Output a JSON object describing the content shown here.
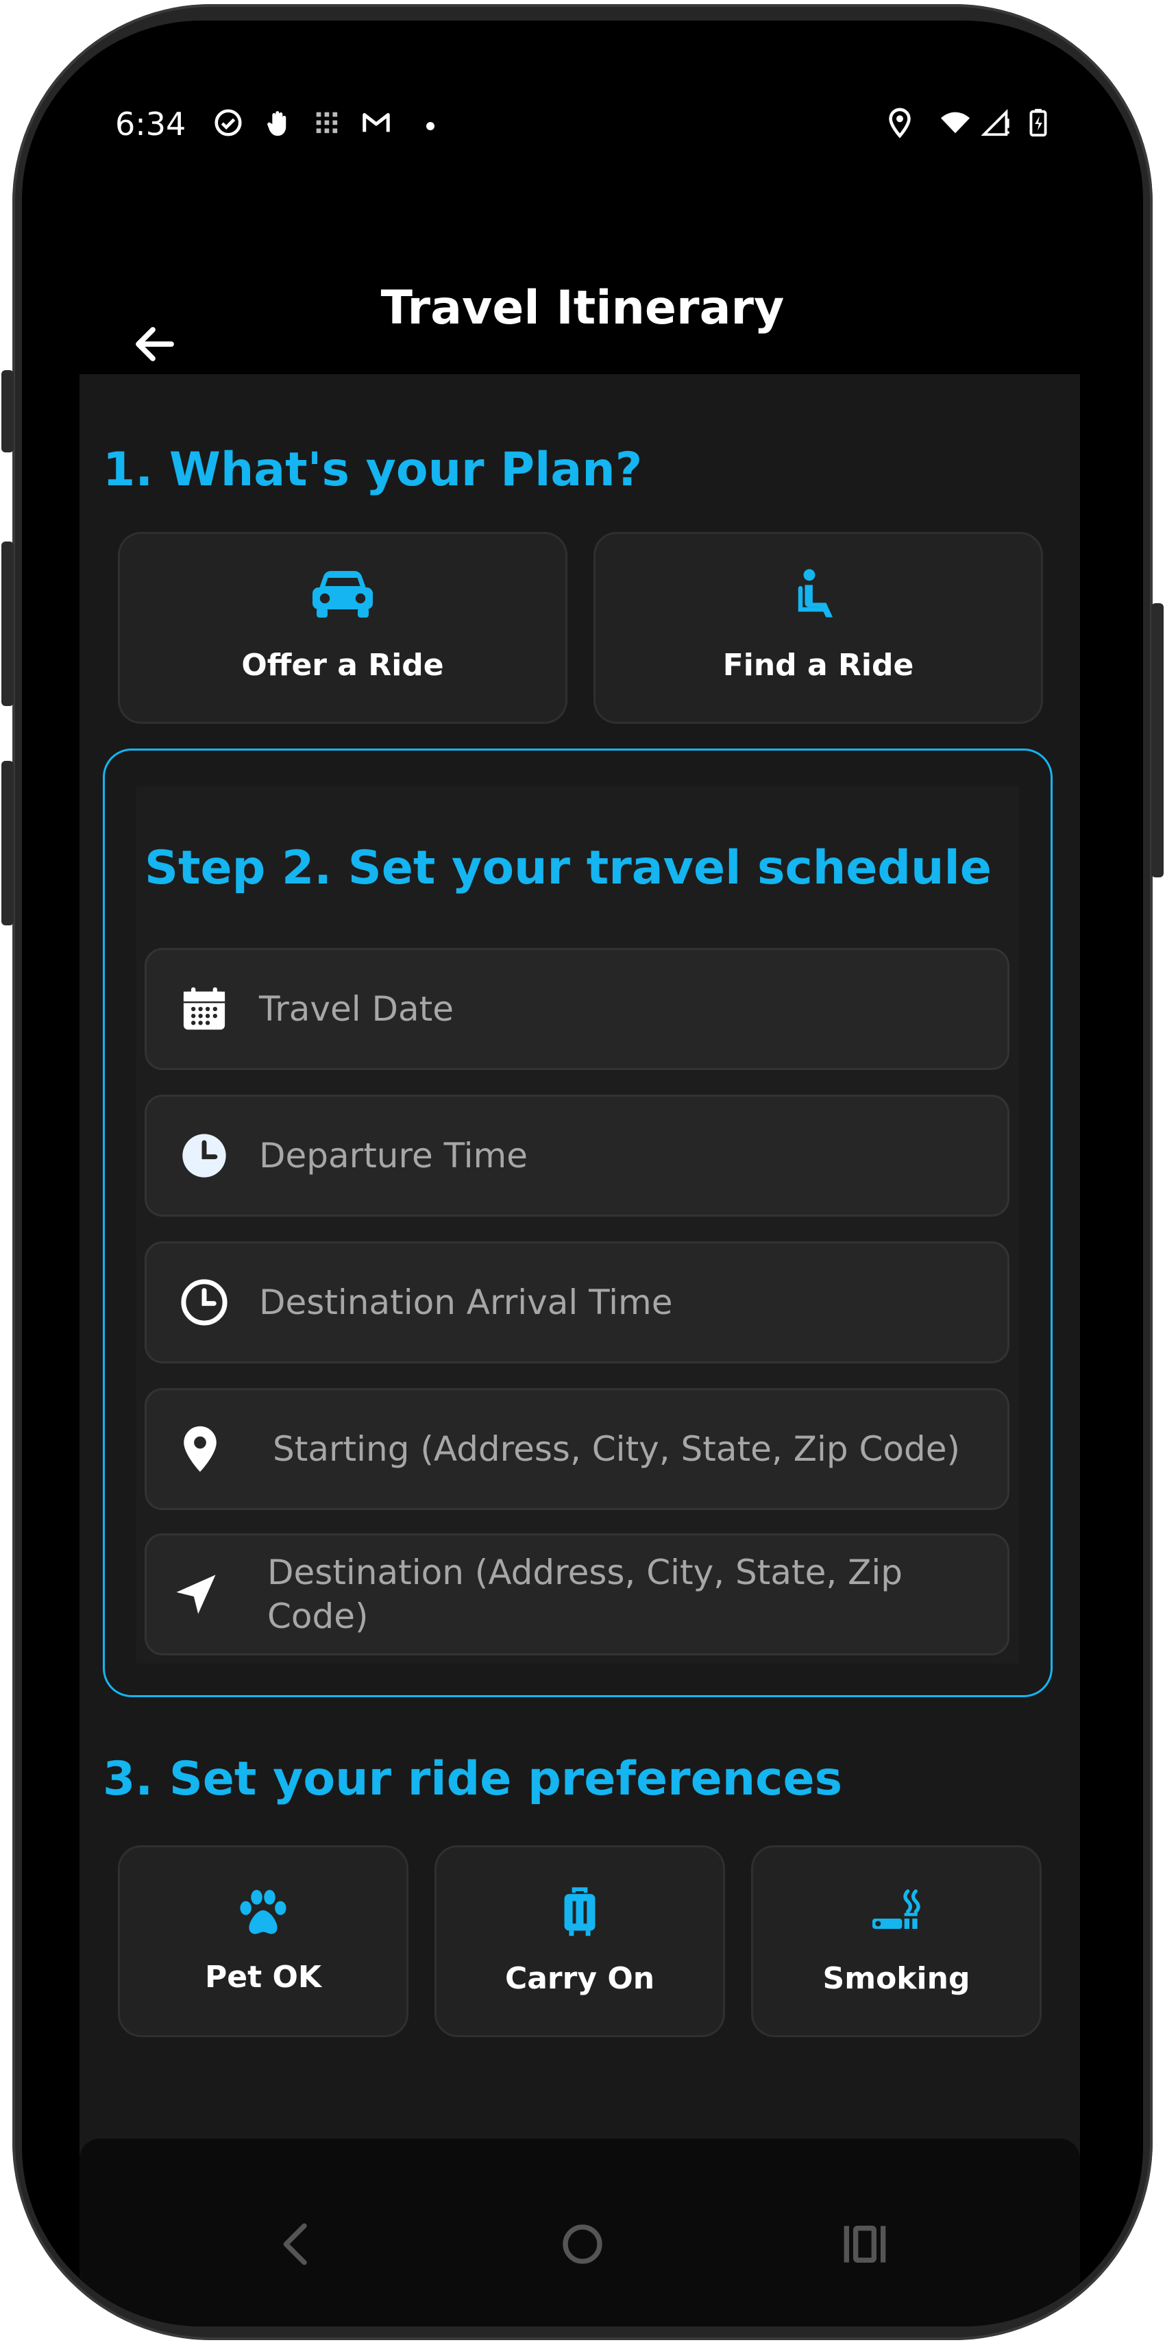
{
  "status_bar": {
    "time": "6:34",
    "left_icons": [
      "check-circle-icon",
      "hand-icon",
      "grid-icon",
      "gmail-icon",
      "dot-icon"
    ],
    "right_icons": [
      "location-icon",
      "wifi-icon",
      "signal-icon",
      "battery-charging-icon"
    ]
  },
  "app_bar": {
    "title": "Travel Itinerary",
    "back_icon": "arrow-left-icon"
  },
  "section1": {
    "heading": "1. What's your Plan?",
    "options": [
      {
        "label": "Offer a Ride",
        "icon": "car-icon"
      },
      {
        "label": "Find a Ride",
        "icon": "seated-person-icon"
      }
    ]
  },
  "section2": {
    "heading": "Step 2. Set your travel schedule",
    "fields": [
      {
        "placeholder": "Travel Date",
        "icon": "calendar-icon"
      },
      {
        "placeholder": "Departure Time",
        "icon": "clock-filled-icon"
      },
      {
        "placeholder": "Destination Arrival Time",
        "icon": "clock-outline-icon"
      },
      {
        "placeholder": "Starting (Address, City, State, Zip Code)",
        "icon": "map-pin-icon"
      },
      {
        "placeholder": "Destination (Address, City, State, Zip Code)",
        "icon": "navigation-arrow-icon"
      }
    ]
  },
  "section3": {
    "heading": "3. Set your ride preferences",
    "options": [
      {
        "label": "Pet OK",
        "icon": "paw-icon"
      },
      {
        "label": "Carry On",
        "icon": "luggage-icon"
      },
      {
        "label": "Smoking",
        "icon": "smoking-icon"
      }
    ]
  },
  "nav_bar": {
    "icons": [
      "nav-back-icon",
      "nav-home-icon",
      "nav-recents-icon"
    ]
  },
  "colors": {
    "accent": "#14b5f0",
    "panel": "#191919",
    "card": "#222222",
    "placeholder": "#a7a7a7"
  }
}
